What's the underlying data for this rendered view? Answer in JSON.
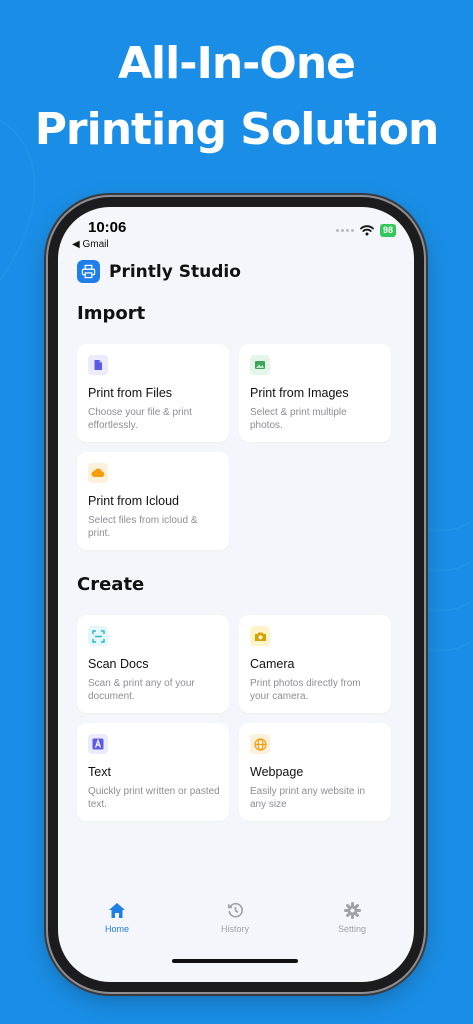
{
  "promo": {
    "line1": "All-In-One",
    "line2": "Printing Solution"
  },
  "status_bar": {
    "time": "10:06",
    "back_app": "◀ Gmail",
    "battery": "98"
  },
  "app": {
    "title": "Printly Studio"
  },
  "import": {
    "title": "Import",
    "cards": [
      {
        "title": "Print from Files",
        "desc": "Choose your file & print effortlessly.",
        "icon": "file-icon",
        "color": "#5b5ce6",
        "bg": "#ecebfd"
      },
      {
        "title": "Print from Images",
        "desc": "Select & print multiple photos.",
        "icon": "image-icon",
        "color": "#3aa657",
        "bg": "#e6f5e9"
      },
      {
        "title": "Print from Icloud",
        "desc": "Select files from icloud & print.",
        "icon": "cloud-icon",
        "color": "#f59e0b",
        "bg": "#fdf1dc"
      }
    ]
  },
  "create": {
    "title": "Create",
    "cards": [
      {
        "title": "Scan Docs",
        "desc": "Scan & print any of your document.",
        "icon": "scan-icon",
        "color": "#22b8cf",
        "bg": "#e6f7fa"
      },
      {
        "title": "Camera",
        "desc": "Print photos directly from your camera.",
        "icon": "camera-icon",
        "color": "#d4a106",
        "bg": "#fdf4cc"
      },
      {
        "title": "Text",
        "desc": "Quickly print written or pasted text.",
        "icon": "text-icon",
        "color": "#5b5ce6",
        "bg": "#ecebfd"
      },
      {
        "title": "Webpage",
        "desc": "Easily print any website in any size",
        "icon": "globe-icon",
        "color": "#f59e0b",
        "bg": "#fdf1dc"
      }
    ]
  },
  "tabs": [
    {
      "label": "Home",
      "icon": "home-icon",
      "active": true
    },
    {
      "label": "History",
      "icon": "history-icon",
      "active": false
    },
    {
      "label": "Setting",
      "icon": "gear-icon",
      "active": false
    }
  ],
  "colors": {
    "background": "#1a8ee6",
    "accent": "#1f7fe8",
    "screen": "#f5f6fb"
  }
}
